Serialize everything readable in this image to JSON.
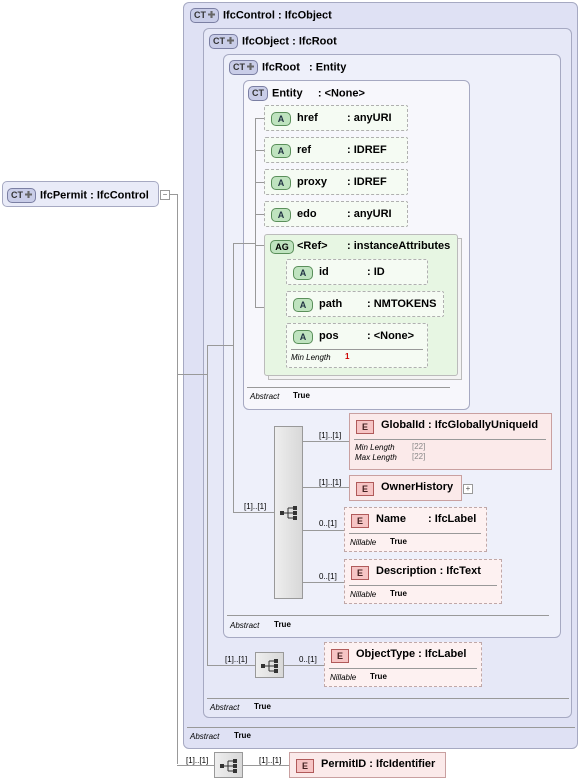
{
  "badges": {
    "ct": "CT",
    "a": "A",
    "ag": "AG",
    "e": "E"
  },
  "root": {
    "name": "IfcPermit",
    "sep": ":",
    "type": "IfcControl"
  },
  "ct_boxes": [
    {
      "name": "IfcControl",
      "type": "IfcObject",
      "abstract_label": "Abstract",
      "abstract_value": "True"
    },
    {
      "name": "IfcObject",
      "type": "IfcRoot",
      "abstract_label": "Abstract",
      "abstract_value": "True"
    },
    {
      "name": "IfcRoot",
      "type": "Entity",
      "abstract_label": "Abstract",
      "abstract_value": "True"
    },
    {
      "name": "Entity",
      "type": "<None>",
      "abstract_label": "Abstract",
      "abstract_value": "True"
    }
  ],
  "attributes": [
    {
      "name": "href",
      "type": ": anyURI"
    },
    {
      "name": "ref",
      "type": ": IDREF"
    },
    {
      "name": "proxy",
      "type": ": IDREF"
    },
    {
      "name": "edo",
      "type": ": anyURI"
    }
  ],
  "attr_group": {
    "name": "<Ref>",
    "type": ": instanceAttributes",
    "items": [
      {
        "name": "id",
        "type": ": ID"
      },
      {
        "name": "path",
        "type": ": NMTOKENS"
      },
      {
        "name": "pos",
        "type": ": <None>",
        "meta_label": "Min Length",
        "meta_value": "1"
      }
    ]
  },
  "elements": {
    "globalid": {
      "label": "GlobalId : IfcGloballyUniqueId",
      "card": "[1]..[1]",
      "meta1_label": "Min Length",
      "meta1_value": "[22]",
      "meta2_label": "Max Length",
      "meta2_value": "[22]"
    },
    "ownerhistory": {
      "label": "OwnerHistory",
      "card": "[1]..[1]"
    },
    "name": {
      "label": "Name",
      "type": ": IfcLabel",
      "card": "0..[1]",
      "meta_label": "Nillable",
      "meta_value": "True"
    },
    "description": {
      "label": "Description : IfcText",
      "card": "0..[1]",
      "meta_label": "Nillable",
      "meta_value": "True"
    },
    "objecttype": {
      "label": "ObjectType : IfcLabel",
      "card": "0..[1]",
      "meta_label": "Nillable",
      "meta_value": "True"
    },
    "permitid": {
      "label": "PermitID : IfcIdentifier",
      "card": "[1]..[1]"
    }
  },
  "sequence_cards": {
    "root_seq": "[1]..[1]",
    "ifccontrol_seq": "[1]..[1]",
    "ifcroot_seq": "[1]..[1]"
  }
}
